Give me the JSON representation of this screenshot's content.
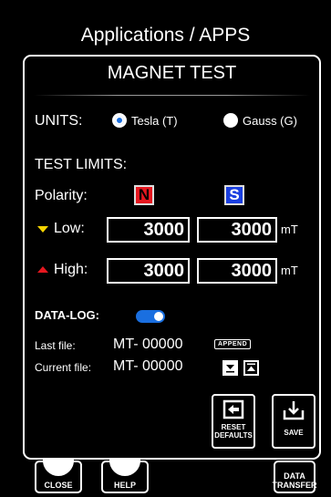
{
  "app_title": "Applications / APPS",
  "dialog": {
    "title": "MAGNET TEST",
    "units_label": "UNITS:",
    "units_options": [
      {
        "label": "Tesla (T)",
        "selected": true
      },
      {
        "label": "Gauss (G)",
        "selected": false
      }
    ],
    "test_limits_label": "TEST LIMITS:",
    "polarity_label": "Polarity:",
    "polarity_n": "N",
    "polarity_s": "S",
    "low_label": "Low:",
    "low_n_value": "3000",
    "low_s_value": "3000",
    "high_label": "High:",
    "high_n_value": "3000",
    "high_s_value": "3000",
    "unit_suffix": "mT",
    "datalog_label": "DATA-LOG:",
    "datalog_enabled": true,
    "last_file_label": "Last file:",
    "last_file_value": "MT- 00000",
    "append_label": "APPEND",
    "current_file_label": "Current file:",
    "current_file_value": "MT- 00000",
    "reset_label_1": "RESET",
    "reset_label_2": "DEFAULTS",
    "save_label": "SAVE"
  },
  "bottom_bar": {
    "close_label": "CLOSE",
    "help_label": "HELP",
    "data_label_1": "DATA",
    "data_label_2": "TRANSFER"
  },
  "colors": {
    "polarity_n_bg": "#e5171f",
    "polarity_s_bg": "#1a3fe0",
    "accent_blue": "#1a6fe0",
    "low_marker": "#f5d400",
    "high_marker": "#e5171f"
  }
}
